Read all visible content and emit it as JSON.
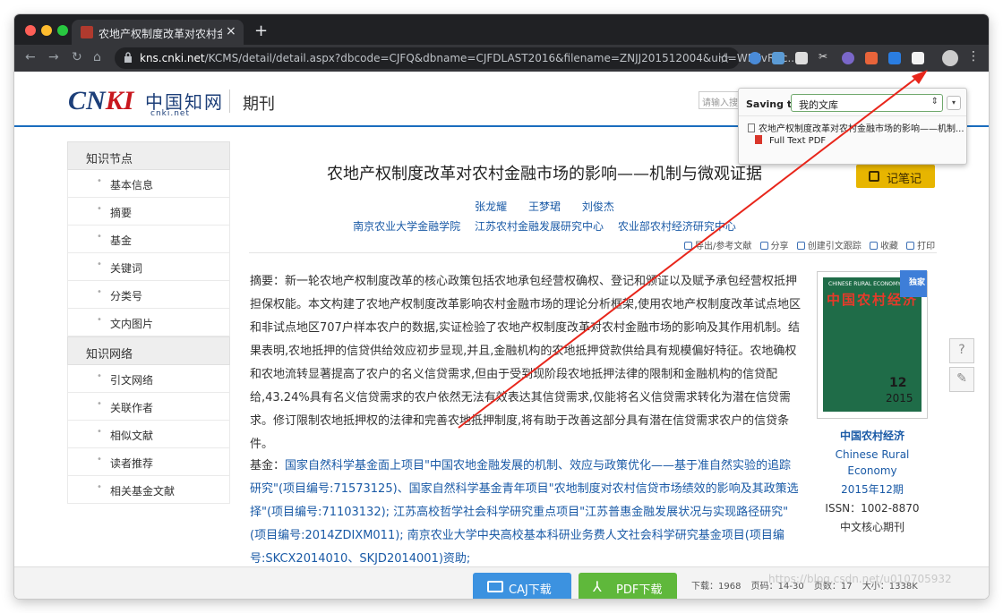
{
  "browser": {
    "tab_title": "农地产权制度改革对农村金融市",
    "tab_close": "×",
    "new_tab": "+",
    "url_domain": "kns.cnki.net",
    "url_path": "/KCMS/detail/detail.aspx?dbcode=CJFQ&dbname=CJFDLAST2016&filename=ZNJJ201512004&uid=WEEvREc...",
    "traffic_light_colors": [
      "#fe5f57",
      "#febc2e",
      "#28c840"
    ]
  },
  "header": {
    "logo_cn": "CNKI",
    "logo_zh": "中国知网",
    "logo_sub": "cnki.net",
    "section": "期刊",
    "search_placeholder": "请输入搜"
  },
  "sidebar": {
    "section1_title": "知识节点",
    "section1_items": [
      "基本信息",
      "摘要",
      "基金",
      "关键词",
      "分类号",
      "文内图片"
    ],
    "section2_title": "知识网络",
    "section2_items": [
      "引文网络",
      "关联作者",
      "相似文献",
      "读者推荐",
      "相关基金文献"
    ]
  },
  "article": {
    "title": "农地产权制度改革对农村金融市场的影响——机制与微观证据",
    "authors": [
      "张龙耀",
      "王梦珺",
      "刘俊杰"
    ],
    "orgs": [
      "南京农业大学金融学院",
      "江苏农村金融发展研究中心",
      "农业部农村经济研究中心"
    ],
    "notes_button": "记笔记",
    "actions": [
      "导出/参考文献",
      "分享",
      "创建引文跟踪",
      "收藏",
      "打印"
    ],
    "abstract_label": "摘要：",
    "abstract": "新一轮农地产权制度改革的核心政策包括农地承包经营权确权、登记和颁证以及赋予承包经营权抵押担保权能。本文构建了农地产权制度改革影响农村金融市场的理论分析框架,使用农地产权制度改革试点地区和非试点地区707户样本农户的数据,实证检验了农地产权制度改革对农村金融市场的影响及其作用机制。结果表明,农地抵押的信贷供给效应初步显现,并且,金融机构的农地抵押贷款供给具有规模偏好特征。农地确权和农地流转显著提高了农户的名义信贷需求,但由于受到现阶段农地抵押法律的限制和金融机构的信贷配给,43.24%具有名义信贷需求的农户依然无法有效表达其信贷需求,仅能将名义信贷需求转化为潜在信贷需求。修订限制农地抵押权的法律和完善农地抵押制度,将有助于改善这部分具有潜在信贷需求农户的信贷条件。",
    "fund_label": "基金：",
    "fund": "国家自然科学基金面上项目\"中国农地金融发展的机制、效应与政策优化——基于准自然实验的追踪研究\"(项目编号:71573125)、国家自然科学基金青年项目\"农地制度对农村信贷市场绩效的影响及其政策选择\"(项目编号:71103132); 江苏高校哲学社会科学研究重点项目\"江苏普惠金融发展状况与实现路径研究\"(项目编号:2014ZDIXM011); 南京农业大学中央高校基本科研业务费人文社会科学研究基金项目(项目编号:SKCX2014010、SKJD2014001)资助;"
  },
  "journal": {
    "cover_title": "中国农村经济",
    "cover_small": "CHINESE RURAL ECONOMY",
    "cover_issue": "12",
    "cover_year": "2015",
    "badge": "独家",
    "name": "中国农村经济",
    "name_en": "Chinese Rural Economy",
    "date": "2015年12期",
    "issn": "ISSN：1002-8870",
    "core": "中文核心期刊"
  },
  "bottom": {
    "caj_label": "CAJ下载",
    "pdf_label": "PDF下载",
    "downloads": "下载：1968",
    "pages": "页码：14-30",
    "page_count": "页数：17",
    "size": "大小：1338K"
  },
  "popup": {
    "saving_to_label": "Saving to",
    "library": "我的文库",
    "item_title": "农地产权制度改革对农村金融市场的影响——机制...",
    "attachment": "Full Text PDF"
  },
  "watermark": "https://blog.csdn.net/u010705932",
  "colors": {
    "accent_blue": "#1a6dbe",
    "link_blue": "#1a5aa6",
    "notes_yellow": "#e7b500",
    "caj_blue": "#3c92e0",
    "pdf_green": "#5fb83b",
    "arrow_red": "#e8261b"
  }
}
